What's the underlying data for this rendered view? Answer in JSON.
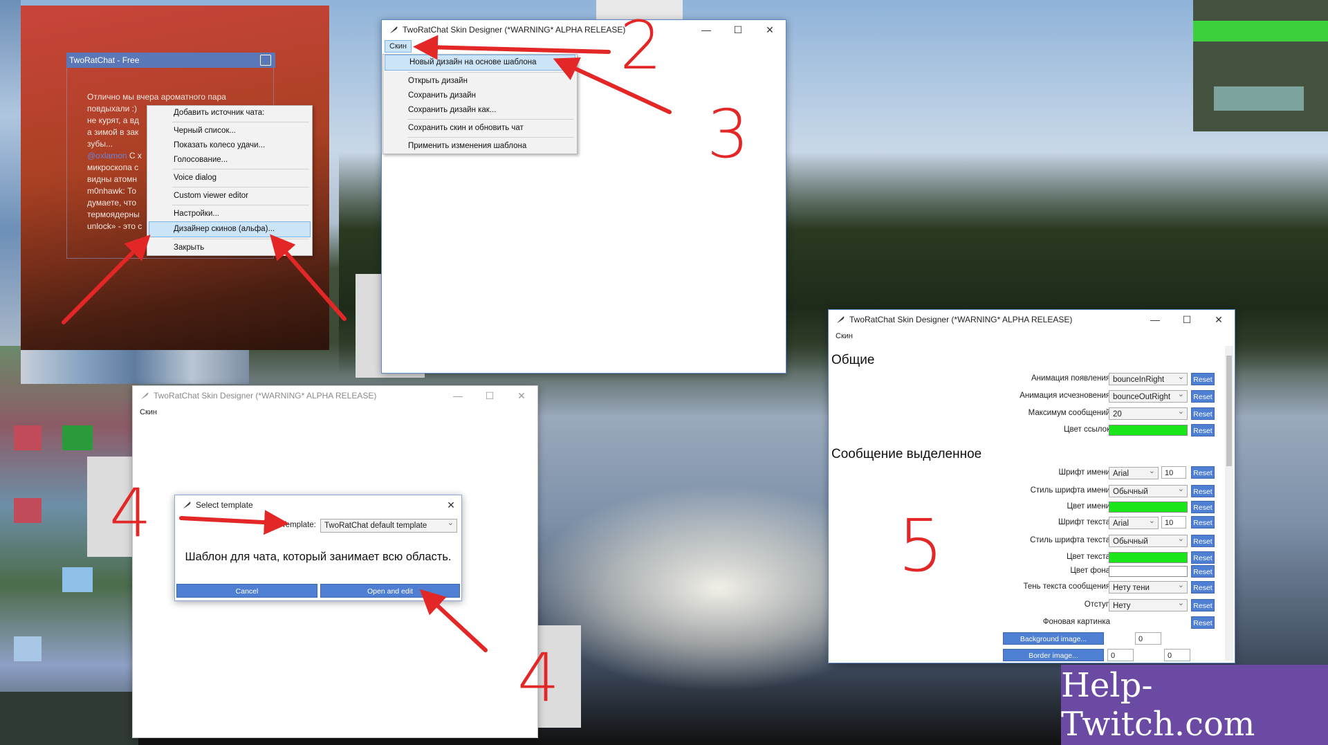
{
  "colors": {
    "accent": "#4f7fd2",
    "green": "#19e619",
    "step_red": "#e32626",
    "watermark_bg": "#6b4aa3"
  },
  "twitch_chat": {
    "title": "TwoRatChat - Free",
    "chat_lines": [
      "Отлично мы вчера ароматного пара",
      "повдыхали :)",
      "не курят, а вд",
      "а зимой в зак",
      "зубы...",
      "С х",
      "микроскопа с",
      "видны атомн",
      "m0nhawk: То",
      "думаете, что",
      "термоядерны",
      "unlock» - это с"
    ],
    "nick": "@oxlamon",
    "context_menu": [
      "Добавить источник чата:",
      "Черный список...",
      "Показать колесо удачи...",
      "Голосование...",
      "Voice dialog",
      "Custom viewer editor",
      "Настройки...",
      "Дизайнер скинов (альфа)...",
      "Закрыть"
    ]
  },
  "designer_top": {
    "title": "TwoRatChat Skin Designer (*WARNING* ALPHA RELEASE)",
    "menu_label": "Скин",
    "dropdown": [
      "Новый дизайн на основе шаблона",
      "Открыть дизайн",
      "Сохранить дизайн",
      "Сохранить дизайн как...",
      "Сохранить скин и обновить чат",
      "Применить изменения шаблона"
    ]
  },
  "designer_left": {
    "title": "TwoRatChat Skin Designer (*WARNING* ALPHA RELEASE)",
    "menu_label": "Скин",
    "dialog": {
      "title": "Select template",
      "template_label": "Template:",
      "template_value": "TwoRatChat default template",
      "description": "Шаблон для чата, который занимает всю область.",
      "cancel": "Cancel",
      "open": "Open and edit"
    }
  },
  "designer_right": {
    "title": "TwoRatChat Skin Designer (*WARNING* ALPHA RELEASE)",
    "menu_label": "Скин",
    "section_general": "Общие",
    "section_highlight": "Сообщение выделенное",
    "reset": "Reset",
    "rows": {
      "anim_in": {
        "label": "Анимация появления",
        "value": "bounceInRight"
      },
      "anim_out": {
        "label": "Анимация исчезновения",
        "value": "bounceOutRight"
      },
      "max_msgs": {
        "label": "Максимум сообщений",
        "value": "20"
      },
      "link_color": {
        "label": "Цвет ссылок"
      },
      "name_font": {
        "label": "Шрифт имени",
        "value": "Arial",
        "size": "10"
      },
      "name_style": {
        "label": "Стиль шрифта имени",
        "value": "Обычный"
      },
      "name_color": {
        "label": "Цвет имени"
      },
      "text_font": {
        "label": "Шрифт текста",
        "value": "Arial",
        "size": "10"
      },
      "text_style": {
        "label": "Стиль шрифта текста",
        "value": "Обычный"
      },
      "text_color": {
        "label": "Цвет текста"
      },
      "bg_color": {
        "label": "Цвет фона"
      },
      "shadow": {
        "label": "Тень текста сообщения",
        "value": "Нету тени"
      },
      "padding": {
        "label": "Отступ",
        "value": "Нету"
      },
      "bg_image": {
        "label": "Фоновая картинка"
      }
    },
    "bg_image_btn": "Background image...",
    "border_image_btn": "Border image...",
    "bg_num": "0",
    "border_num1": "0",
    "border_num2": "0"
  },
  "steps": [
    "2",
    "3",
    "4",
    "4",
    "5"
  ],
  "watermark": "Help-Twitch.com"
}
